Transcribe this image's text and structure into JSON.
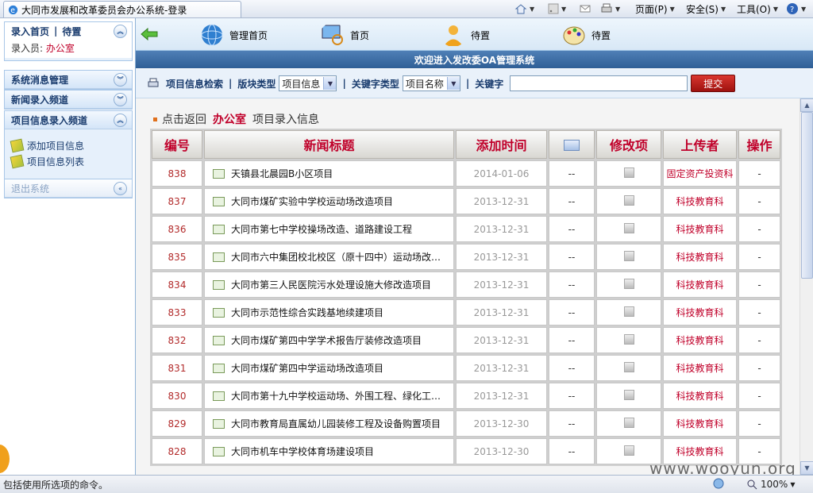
{
  "browser": {
    "tab_title": "大同市发展和改革委员会办公系统-登录",
    "commands": [
      "页面(P)",
      "安全(S)",
      "工具(O)"
    ],
    "status_text": "包括使用所选项的命令。",
    "zoom": "100%",
    "watermark": "www.wooyun.org"
  },
  "sidebar": {
    "top": {
      "title_a": "录入首页",
      "title_b": "待置",
      "user_label": "录入员:",
      "user_value": "办公室"
    },
    "sections": [
      {
        "label": "系统消息管理"
      },
      {
        "label": "新闻录入频道"
      },
      {
        "label": "项目信息录入频道",
        "items": [
          "添加项目信息",
          "项目信息列表"
        ]
      },
      {
        "label": "退出系统"
      }
    ]
  },
  "nav": {
    "items": [
      "管理首页",
      "首页",
      "待置",
      "待置"
    ],
    "welcome": "欢迎进入发改委OA管理系统"
  },
  "search": {
    "title": "项目信息检索",
    "block_type_label": "版块类型",
    "block_type_value": "项目信息",
    "kw_type_label": "关键字类型",
    "kw_type_value": "项目名称",
    "kw_label": "关键字",
    "submit_label": "提交"
  },
  "crumb": {
    "back": "点击返回",
    "office": "办公室",
    "page": "项目录入信息"
  },
  "table": {
    "headers": [
      "编号",
      "新闻标题",
      "添加时间",
      "",
      "修改项",
      "上传者",
      "操作"
    ],
    "rows": [
      {
        "id": "838",
        "title": "天镇县北晨园B小区项目",
        "date": "2014-01-06",
        "flag": "--",
        "uploader": "固定资产投资科",
        "op": "-"
      },
      {
        "id": "837",
        "title": "大同市煤矿实验中学校运动场改造项目",
        "date": "2013-12-31",
        "flag": "--",
        "uploader": "科技教育科",
        "op": "-"
      },
      {
        "id": "836",
        "title": "大同市第七中学校操场改造、道路建设工程",
        "date": "2013-12-31",
        "flag": "--",
        "uploader": "科技教育科",
        "op": "-"
      },
      {
        "id": "835",
        "title": "大同市六中集团校北校区（原十四中）运动场改…",
        "date": "2013-12-31",
        "flag": "--",
        "uploader": "科技教育科",
        "op": "-"
      },
      {
        "id": "834",
        "title": "大同市第三人民医院污水处理设施大修改造项目",
        "date": "2013-12-31",
        "flag": "--",
        "uploader": "科技教育科",
        "op": "-"
      },
      {
        "id": "833",
        "title": "大同市示范性综合实践基地续建项目",
        "date": "2013-12-31",
        "flag": "--",
        "uploader": "科技教育科",
        "op": "-"
      },
      {
        "id": "832",
        "title": "大同市煤矿第四中学学术报告厅装修改造项目",
        "date": "2013-12-31",
        "flag": "--",
        "uploader": "科技教育科",
        "op": "-"
      },
      {
        "id": "831",
        "title": "大同市煤矿第四中学运动场改造项目",
        "date": "2013-12-31",
        "flag": "--",
        "uploader": "科技教育科",
        "op": "-"
      },
      {
        "id": "830",
        "title": "大同市第十九中学校运动场、外围工程、绿化工…",
        "date": "2013-12-31",
        "flag": "--",
        "uploader": "科技教育科",
        "op": "-"
      },
      {
        "id": "829",
        "title": "大同市教育局直属幼儿园装修工程及设备购置项目",
        "date": "2013-12-30",
        "flag": "--",
        "uploader": "科技教育科",
        "op": "-"
      },
      {
        "id": "828",
        "title": "大同市机车中学校体育场建设项目",
        "date": "2013-12-30",
        "flag": "--",
        "uploader": "科技教育科",
        "op": "-"
      }
    ]
  }
}
